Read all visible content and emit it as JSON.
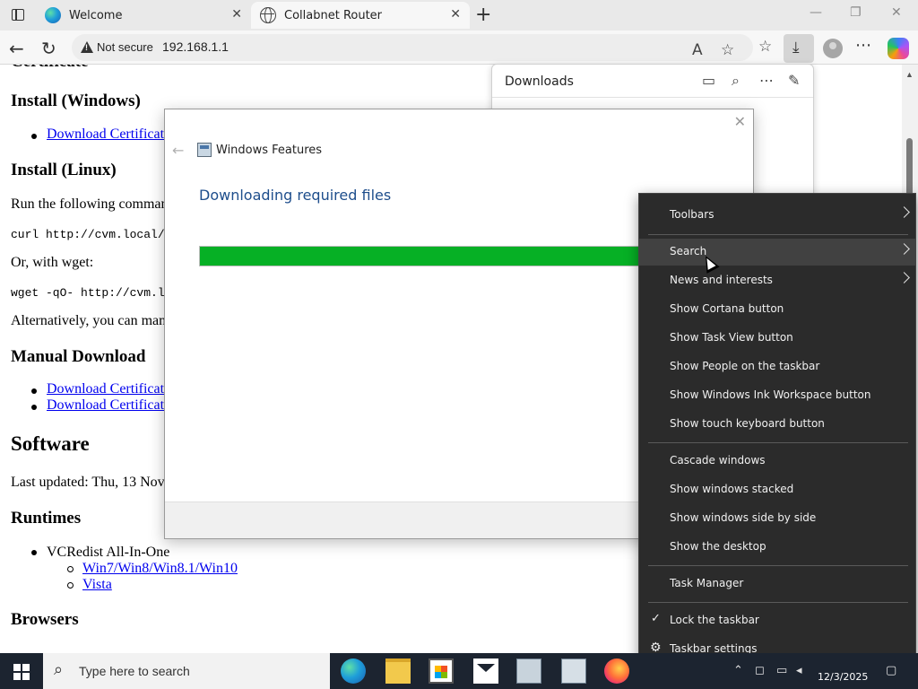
{
  "browser": {
    "tabs": [
      {
        "title": "Welcome",
        "close": "✕"
      },
      {
        "title": "Collabnet Router",
        "close": "✕"
      }
    ],
    "new_tab": "+",
    "security_label": "Not secure",
    "url": "192.168.1.1"
  },
  "page": {
    "headings": {
      "install_windows": "Install (Windows)",
      "install_linux": "Install (Linux)",
      "manual_download": "Manual Download",
      "software": "Software",
      "runtimes": "Runtimes",
      "browsers": "Browsers"
    },
    "install_windows_link": "Download Certificat",
    "linux_text": "Run the following comman",
    "curl_cmd": "curl http://cvm.local/l",
    "wget_text": "Or, with wget:",
    "wget_cmd": "wget -qO- http://cvm.loc",
    "alt_text": "Alternatively, you can man",
    "manual_links": [
      "Download Certificat",
      "Download Certificat"
    ],
    "last_updated": "Last updated: Thu, 13 Nov",
    "runtime_item": "VCRedist All-In-One",
    "runtime_links": [
      "Win7/Win8/Win8.1/Win10",
      "Vista"
    ]
  },
  "downloads_panel": {
    "title": "Downloads"
  },
  "dialog": {
    "window_title": "Windows Features",
    "heading": "Downloading required files",
    "progress": 0.83,
    "close": "✕"
  },
  "context_menu": {
    "items": [
      {
        "label": "Toolbars",
        "submenu": true
      },
      {
        "label": "Search",
        "submenu": true
      },
      {
        "label": "News and interests",
        "submenu": true
      },
      {
        "label": "Show Cortana button"
      },
      {
        "label": "Show Task View button"
      },
      {
        "label": "Show People on the taskbar"
      },
      {
        "label": "Show Windows Ink Workspace button"
      },
      {
        "label": "Show touch keyboard button"
      },
      {
        "label": "Cascade windows"
      },
      {
        "label": "Show windows stacked"
      },
      {
        "label": "Show windows side by side"
      },
      {
        "label": "Show the desktop"
      },
      {
        "label": "Task Manager"
      },
      {
        "label": "Lock the taskbar",
        "checked": true
      },
      {
        "label": "Taskbar settings"
      }
    ]
  },
  "taskbar": {
    "search_placeholder": "Type here to search",
    "date": "12/3/2025"
  },
  "colors": {
    "progress_fill": "#06b025",
    "link": "#0000ee",
    "menu_bg": "#2b2b2b",
    "taskbar_bg": "#1c2430"
  }
}
